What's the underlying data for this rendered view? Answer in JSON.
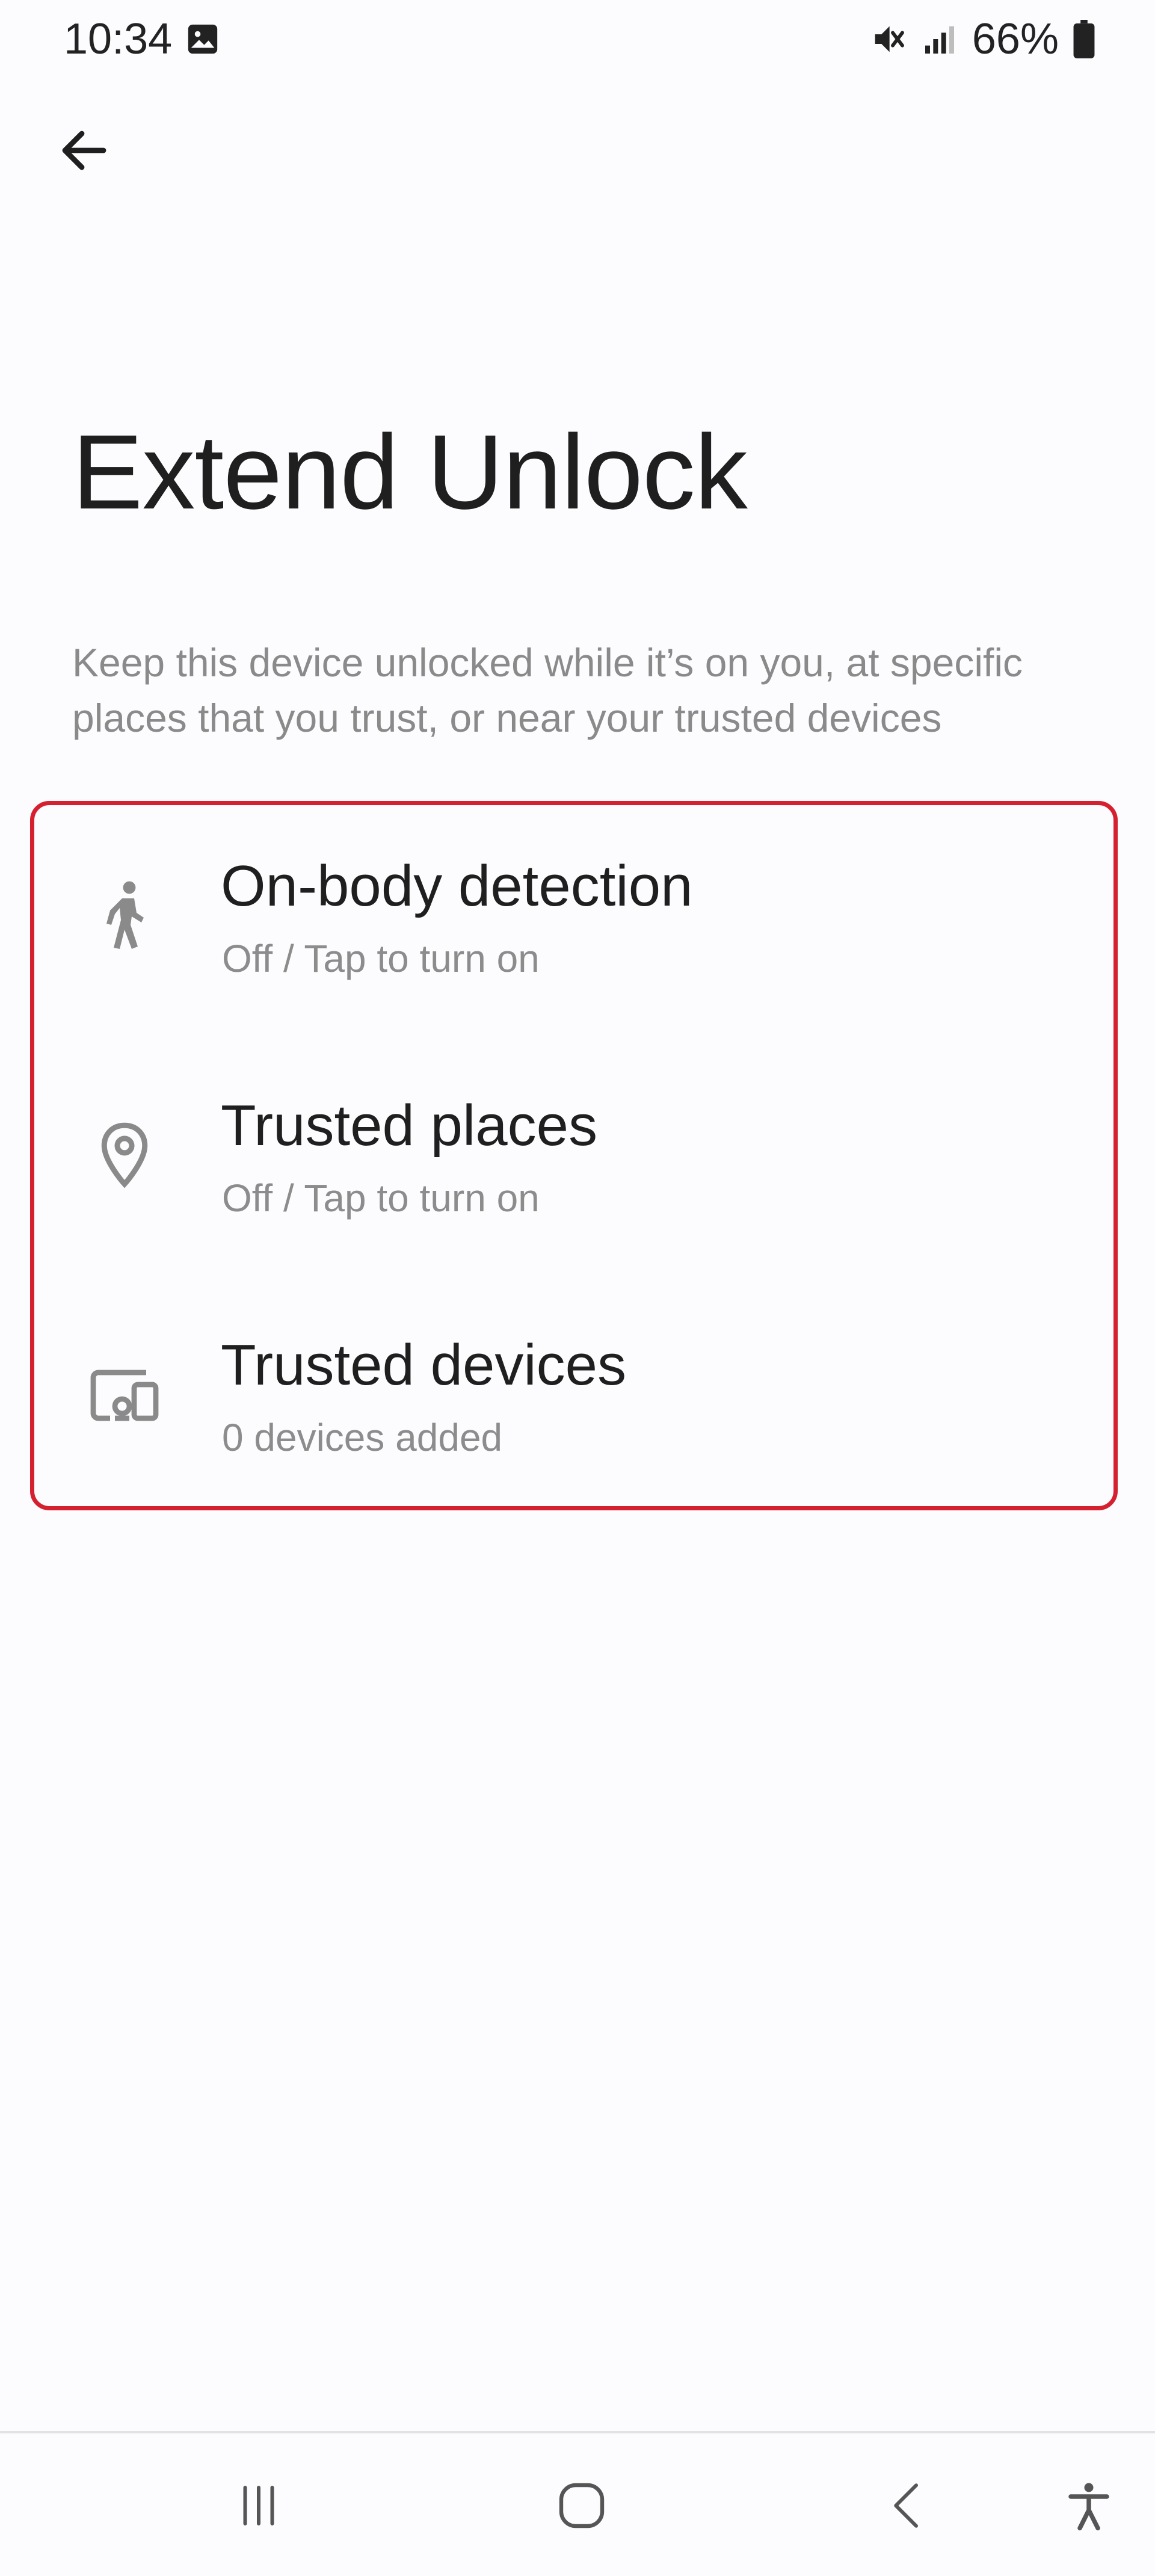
{
  "status_bar": {
    "time": "10:34",
    "notification_icon": "gallery-image-icon",
    "sound_icon": "mute-icon",
    "signal_icon": "signal-bars-icon",
    "battery_percent": "66%",
    "battery_icon": "battery-icon"
  },
  "header": {
    "back_icon": "arrow-back-icon"
  },
  "page": {
    "title": "Extend Unlock",
    "description": "Keep this device unlocked while it’s on you, at specific places that you trust, or near your trusted devices"
  },
  "options": [
    {
      "icon": "walking-person-icon",
      "title": "On-body detection",
      "subtitle": "Off / Tap to turn on"
    },
    {
      "icon": "location-pin-icon",
      "title": "Trusted places",
      "subtitle": "Off / Tap to turn on"
    },
    {
      "icon": "devices-icon",
      "title": "Trusted devices",
      "subtitle": "0 devices added"
    }
  ],
  "highlight_color": "#d5202f",
  "nav_bar": {
    "recent_icon": "recent-apps-icon",
    "home_icon": "home-icon",
    "back_icon": "nav-back-icon",
    "accessibility_icon": "accessibility-icon"
  }
}
